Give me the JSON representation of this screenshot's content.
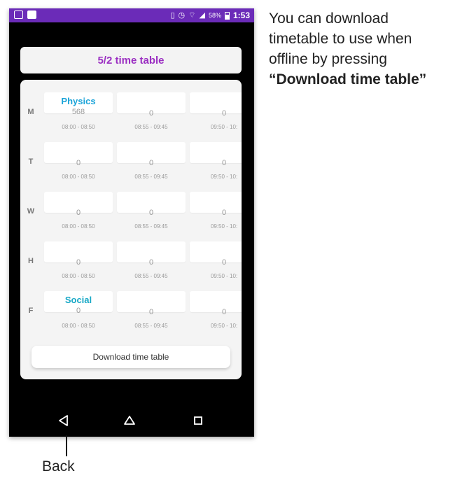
{
  "status_bar": {
    "battery_percent": "58%",
    "time": "1:53",
    "icons": [
      "app-icon",
      "image-icon",
      "vibrate-icon",
      "alarm-icon",
      "wifi-icon",
      "signal-icon",
      "battery-icon"
    ]
  },
  "header": {
    "title": "5/2 time table"
  },
  "timetable": {
    "days": [
      {
        "label": "M",
        "cells": [
          {
            "subject": "Physics",
            "value": "568",
            "time": "08:00 - 08:50"
          },
          {
            "subject": "",
            "value": "0",
            "time": "08:55 - 09:45"
          },
          {
            "subject": "",
            "value": "0",
            "time": "09:50 - 10:"
          }
        ]
      },
      {
        "label": "T",
        "cells": [
          {
            "subject": "",
            "value": "0",
            "time": "08:00 - 08:50"
          },
          {
            "subject": "",
            "value": "0",
            "time": "08:55 - 09:45"
          },
          {
            "subject": "",
            "value": "0",
            "time": "09:50 - 10:"
          }
        ]
      },
      {
        "label": "W",
        "cells": [
          {
            "subject": "",
            "value": "0",
            "time": "08:00 - 08:50"
          },
          {
            "subject": "",
            "value": "0",
            "time": "08:55 - 09:45"
          },
          {
            "subject": "",
            "value": "0",
            "time": "09:50 - 10:"
          }
        ]
      },
      {
        "label": "H",
        "cells": [
          {
            "subject": "",
            "value": "0",
            "time": "08:00 - 08:50"
          },
          {
            "subject": "",
            "value": "0",
            "time": "08:55 - 09:45"
          },
          {
            "subject": "",
            "value": "0",
            "time": "09:50 - 10:"
          }
        ]
      },
      {
        "label": "F",
        "cells": [
          {
            "subject": "Social",
            "value": "0",
            "time": "08:00 - 08:50"
          },
          {
            "subject": "",
            "value": "0",
            "time": "08:55 - 09:45"
          },
          {
            "subject": "",
            "value": "0",
            "time": "09:50 - 10:"
          }
        ]
      }
    ]
  },
  "download_button": {
    "label": "Download time table"
  },
  "nav_bar": {
    "icons": [
      "back-icon",
      "home-icon",
      "recents-icon"
    ]
  },
  "annotation": {
    "lines": [
      "You can download",
      "timetable to use when",
      "offline by pressing"
    ],
    "highlight": "“Download time table”",
    "pointer_label": "Back"
  },
  "colors": {
    "status_bar": "#6b2bb8",
    "title": "#9b2fc2",
    "subject": "#1aa3d8"
  }
}
